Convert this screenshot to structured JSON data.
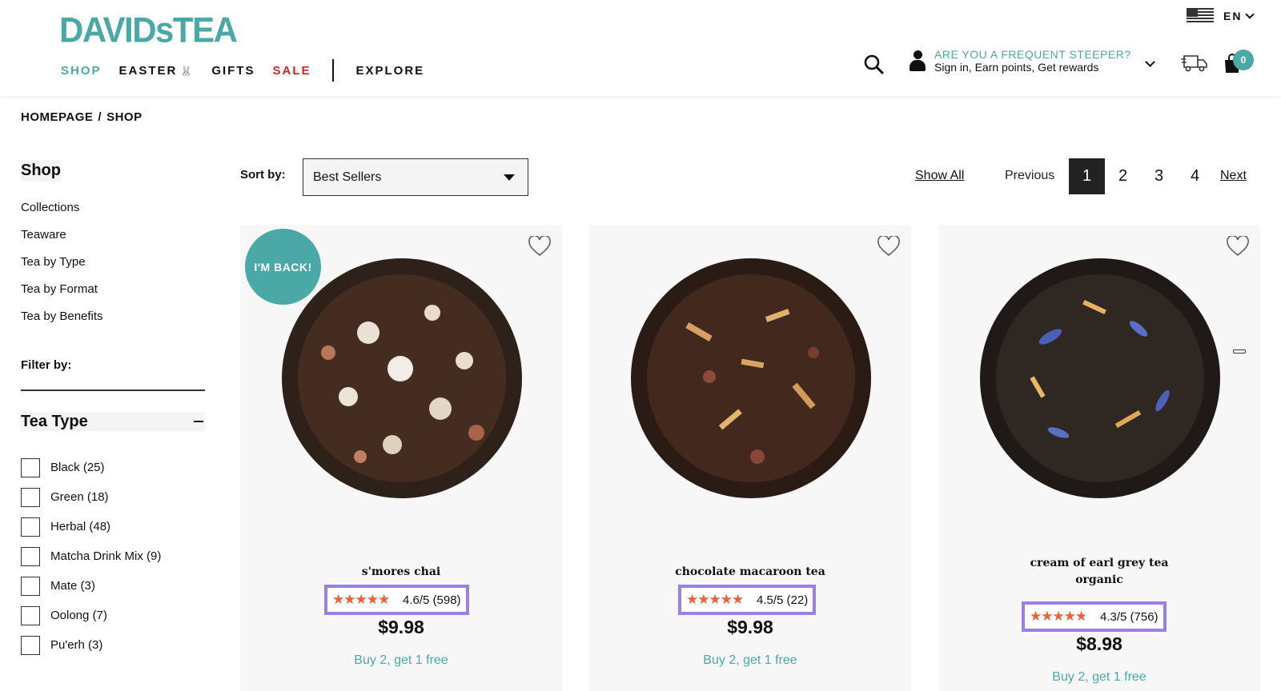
{
  "header": {
    "logo_main": "DAVIDs",
    "logo_tail": "TEA",
    "nav": [
      {
        "label": "SHOP"
      },
      {
        "label": "EASTER"
      },
      {
        "label": "GIFTS"
      },
      {
        "label": "SALE"
      },
      {
        "label": "EXPLORE"
      }
    ],
    "language": "EN",
    "account_title": "ARE YOU A FREQUENT STEEPER?",
    "account_subtitle": "Sign in, Earn points, Get rewards",
    "cart_count": "0",
    "accent_color": "#4aa8a6",
    "sale_color": "#d2232a"
  },
  "breadcrumb": [
    "HOMEPAGE",
    "/",
    "SHOP"
  ],
  "sidebar": {
    "title": "Shop",
    "links": [
      "Collections",
      "Teaware",
      "Tea by Type",
      "Tea by Format",
      "Tea by Benefits"
    ],
    "filter_label": "Filter by:",
    "filter_group": "Tea Type",
    "filters": [
      "Black (25)",
      "Green (18)",
      "Herbal (48)",
      "Matcha Drink Mix (9)",
      "Mate (3)",
      "Oolong (7)",
      "Pu'erh (3)"
    ]
  },
  "toolbar": {
    "sort_label": "Sort by:",
    "sort_value": "Best Sellers",
    "show_all": "Show All",
    "previous": "Previous",
    "pages": [
      "1",
      "2",
      "3",
      "4"
    ],
    "current_page": "1",
    "next": "Next"
  },
  "products": [
    {
      "name_line1": "s'mores chai",
      "name_line2": "",
      "badge": "I'M BACK!",
      "rating_value": 4.6,
      "rating_text": "4.6/5 (598)",
      "price": "$9.98",
      "promo": "Buy 2, get 1 free"
    },
    {
      "name_line1": "chocolate macaroon tea",
      "name_line2": "",
      "badge": "",
      "rating_value": 4.5,
      "rating_text": "4.5/5 (22)",
      "price": "$9.98",
      "promo": "Buy 2, get 1 free"
    },
    {
      "name_line1": "cream of earl grey tea",
      "name_line2": "organic",
      "badge": "",
      "rating_value": 4.3,
      "rating_text": "4.3/5 (756)",
      "price": "$8.98",
      "promo": "Buy 2, get 1 free"
    }
  ]
}
